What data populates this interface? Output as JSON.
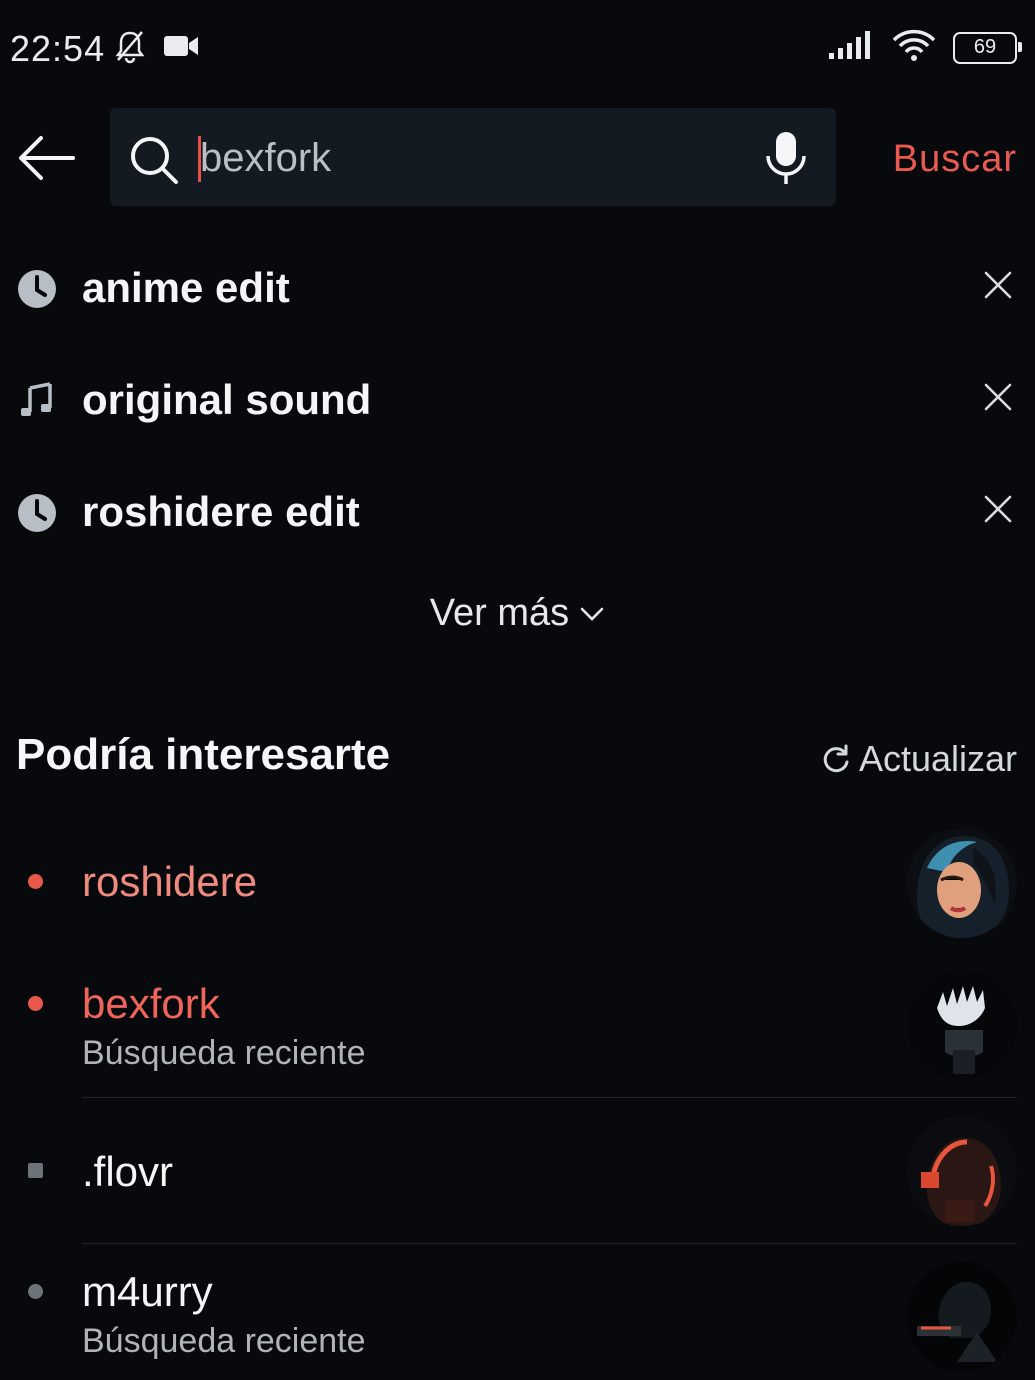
{
  "status_bar": {
    "time": "22:54",
    "battery": "69",
    "icons": [
      "bell-off-icon",
      "video-camera-icon",
      "signal-icon",
      "wifi-icon",
      "battery-icon"
    ]
  },
  "search": {
    "value": "bexfork",
    "submit_label": "Buscar",
    "icons": [
      "back-arrow-icon",
      "search-icon",
      "microphone-icon"
    ]
  },
  "history": [
    {
      "label": "anime edit",
      "icon": "clock-icon"
    },
    {
      "label": "original sound",
      "icon": "music-note-icon"
    },
    {
      "label": "roshidere edit",
      "icon": "clock-icon"
    }
  ],
  "ver_mas": {
    "label": "Ver más"
  },
  "suggestions_section": {
    "title": "Podría interesarte",
    "refresh_label": "Actualizar"
  },
  "suggestions": [
    {
      "label": "roshidere",
      "sub": "",
      "dot_color": "#e8594b",
      "label_color": "#f08a7e"
    },
    {
      "label": "bexfork",
      "sub": "Búsqueda reciente",
      "dot_color": "#e8594b",
      "label_color": "#f0655a"
    },
    {
      "label": ".flovr",
      "sub": "",
      "dot_color": "#6d737a",
      "label_color": "#f3f5f7"
    },
    {
      "label": "m4urry",
      "sub": "Búsqueda reciente",
      "dot_color": "#6d737a",
      "label_color": "#f3f5f7"
    }
  ],
  "colors": {
    "accent": "#e85a4f",
    "background": "#07090c",
    "search_bg": "#131a22"
  }
}
